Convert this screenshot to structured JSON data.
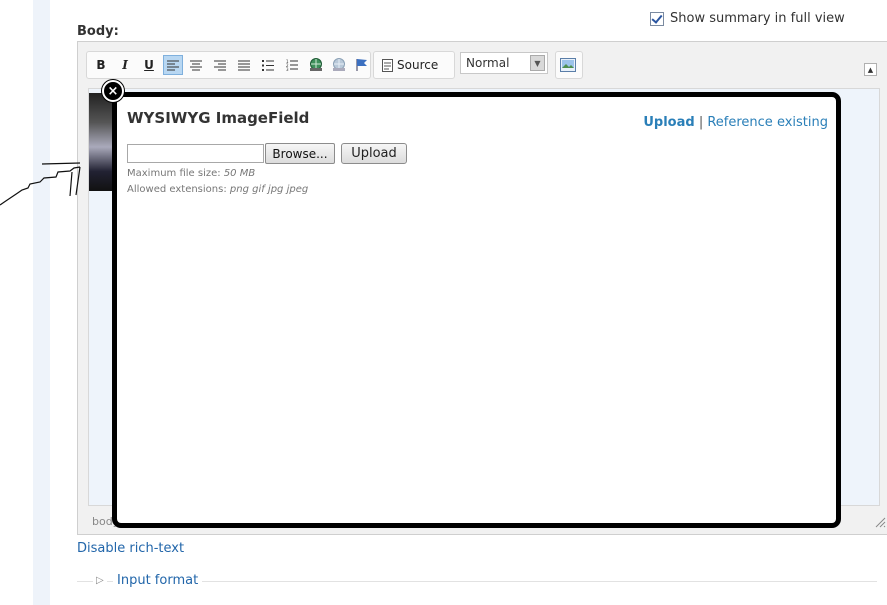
{
  "summary": {
    "label": "Show summary in full view",
    "checked": true
  },
  "body_label": "Body:",
  "toolbar": {
    "bold": "B",
    "italic": "I",
    "underline": "U",
    "source_label": "Source",
    "format_value": "Normal"
  },
  "status_path": "body",
  "disable_link": "Disable rich-text",
  "input_format": "Input format",
  "modal": {
    "title": "WYSIWYG ImageField",
    "upload_tab": "Upload",
    "separator": "|",
    "reference_tab": "Reference existing",
    "browse_label": "Browse...",
    "upload_button": "Upload",
    "max_size_label": "Maximum file size:",
    "max_size_value": "50 MB",
    "extensions_label": "Allowed extensions:",
    "extensions_value": "png gif jpg jpeg",
    "close_glyph": "×"
  }
}
